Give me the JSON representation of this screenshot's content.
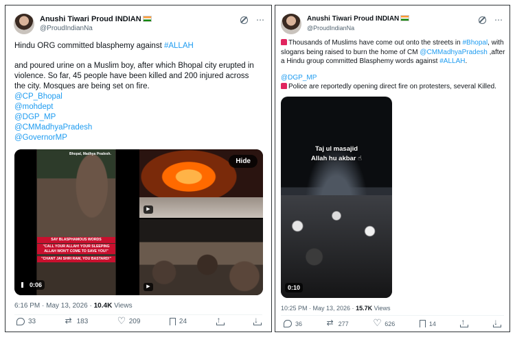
{
  "tweet1": {
    "author_name": "Anushi Tiwari Proud INDIAN",
    "handle": "@ProudIndianNa",
    "text_line1_prefix": "Hindu ORG committed blasphemy against ",
    "text_line1_tag": "#ALLAH",
    "text_body": "and poured urine on a Muslim boy, after which Bhopal city erupted in violence. So far, 45 people have been killed and 200 injured across the city. Mosques are being set on fire.",
    "mentions": [
      "@CP_Bhopal",
      "@mohdept",
      "@DGP_MP",
      "@CMMadhyaPradesh",
      "@GovernorMP"
    ],
    "video_caption": "Bhopal, Madhya Pradesh.",
    "video_banner1": "SAY BLASPHAMOUS WORDS",
    "video_banner2": "\"CALL YOUR ALLAH! YOUR SLEEPING ALLAH WON'T COME TO SAVE YOU!\"",
    "video_banner3": "\"CHANT JAI SHRI RAM, YOU BASTARD!\"",
    "video_duration": "0:06",
    "hide_label": "Hide",
    "timestamp": "6:16 PM · May 13, 2026 · ",
    "views_count": "10.4K",
    "views_label": " Views",
    "replies": "33",
    "reposts": "183",
    "likes": "209",
    "bookmarks": "24"
  },
  "tweet2": {
    "author_name": "Anushi Tiwari Proud INDIAN",
    "handle": "@ProudIndianNa",
    "text_p1_a": "Thousands of Muslims have come out onto the streets in ",
    "text_p1_tag": "#Bhopal",
    "text_p1_b": ", with slogans being raised to  burn the home of CM ",
    "text_p1_mention": "@CMMadhyaPradesh",
    "text_p1_c": " ,after a Hindu group committed Blasphemy words against ",
    "text_p1_tag2": "#ALLAH",
    "text_p1_d": ".",
    "mention_dgp": "@DGP_MP",
    "text_p2": "Police are reportedly opening direct fire on protesters, several Killed.",
    "video_overlay1": "Taj ul masajid",
    "video_overlay2": "Allah hu akbar ☝",
    "video_duration": "0:10",
    "timestamp": "10:25 PM · May 13, 2026 · ",
    "views_count": "15.7K",
    "views_label": " Views",
    "replies": "36",
    "reposts": "277",
    "likes": "626",
    "bookmarks": "14"
  },
  "colors": {
    "link": "#1d9bf0",
    "muted": "#536471",
    "text": "#0f1419"
  },
  "icons": [
    "grok-icon",
    "more-icon",
    "reply-icon",
    "repost-icon",
    "like-icon",
    "bookmark-icon",
    "share-icon",
    "download-icon",
    "siren-icon",
    "india-flag-icon"
  ]
}
